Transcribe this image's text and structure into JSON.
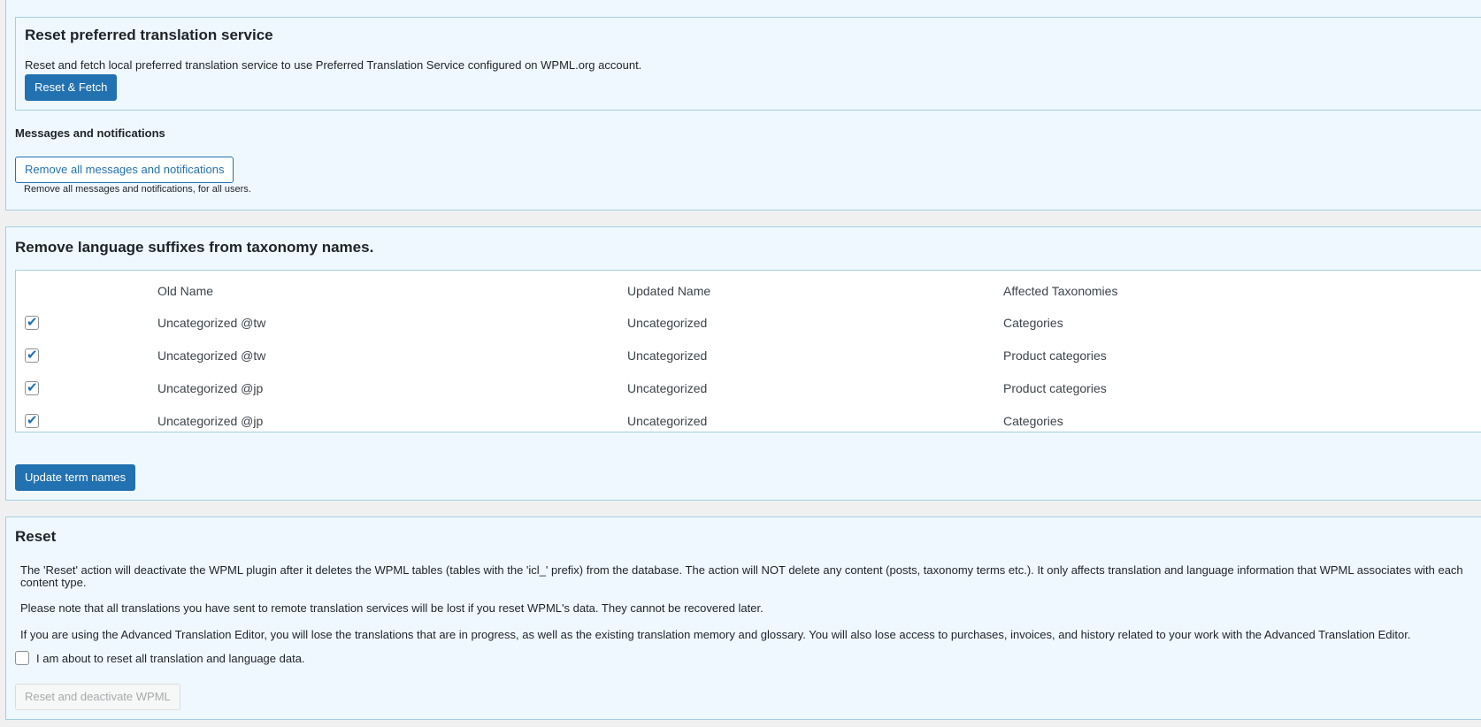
{
  "preferred_service": {
    "title": "Reset preferred translation service",
    "description": "Reset and fetch local preferred translation service to use Preferred Translation Service configured on WPML.org account.",
    "button_label": "Reset & Fetch"
  },
  "messages": {
    "heading": "Messages and notifications",
    "button_label": "Remove all messages and notifications",
    "hint": "Remove all messages and notifications, for all users."
  },
  "suffixes": {
    "title": "Remove language suffixes from taxonomy names.",
    "columns": [
      "Old Name",
      "Updated Name",
      "Affected Taxonomies"
    ],
    "rows": [
      {
        "checked": true,
        "old_name": "Uncategorized @tw",
        "updated_name": "Uncategorized",
        "taxonomies": "Categories"
      },
      {
        "checked": true,
        "old_name": "Uncategorized @tw",
        "updated_name": "Uncategorized",
        "taxonomies": "Product categories"
      },
      {
        "checked": true,
        "old_name": "Uncategorized @jp",
        "updated_name": "Uncategorized",
        "taxonomies": "Product categories"
      },
      {
        "checked": true,
        "old_name": "Uncategorized @jp",
        "updated_name": "Uncategorized",
        "taxonomies": "Categories"
      }
    ],
    "button_label": "Update term names"
  },
  "reset": {
    "title": "Reset",
    "paragraph_1": "The 'Reset' action will deactivate the WPML plugin after it deletes the WPML tables (tables with the 'icl_' prefix) from the database. The action will NOT delete any content (posts, taxonomy terms etc.). It only affects translation and language information that WPML associates with each content type.",
    "paragraph_2": "Please note that all translations you have sent to remote translation services will be lost if you reset WPML's data. They cannot be recovered later.",
    "paragraph_3": "If you are using the Advanced Translation Editor, you will lose the translations that are in progress, as well as the existing translation memory and glossary. You will also lose access to purchases, invoices, and history related to your work with the Advanced Translation Editor.",
    "confirm_label": "I am about to reset all translation and language data.",
    "button_label": "Reset and deactivate WPML"
  },
  "colors": {
    "accent": "#2271b1",
    "panel_bg": "#f0f8ff",
    "panel_border": "#a3cfe0",
    "page_bg": "#f0f0f1"
  }
}
